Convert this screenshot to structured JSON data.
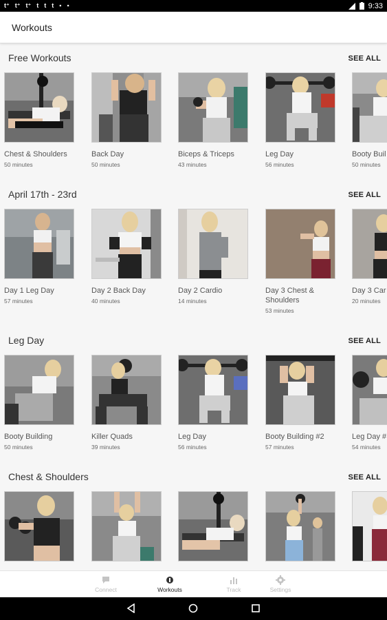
{
  "status_bar": {
    "time": "9:33"
  },
  "app_bar": {
    "title": "Workouts"
  },
  "sections": [
    {
      "title": "Free Workouts",
      "see_all": "SEE ALL",
      "cards": [
        {
          "title": "Chest & Shoulders",
          "duration": "50 minutes"
        },
        {
          "title": "Back Day",
          "duration": "50 minutes"
        },
        {
          "title": "Biceps & Triceps",
          "duration": "43 minutes"
        },
        {
          "title": "Leg Day",
          "duration": "56 minutes"
        },
        {
          "title": "Booty Buil",
          "duration": "50 minutes"
        }
      ]
    },
    {
      "title": "April 17th - 23rd",
      "see_all": "SEE ALL",
      "cards": [
        {
          "title": "Day 1 Leg Day",
          "duration": "57 minutes"
        },
        {
          "title": "Day 2 Back Day",
          "duration": "40 minutes"
        },
        {
          "title": "Day 2 Cardio",
          "duration": "14 minutes"
        },
        {
          "title": "Day 3 Chest & Shoulders",
          "duration": "53 minutes"
        },
        {
          "title": "Day 3 Car",
          "duration": "20 minutes"
        }
      ]
    },
    {
      "title": "Leg Day",
      "see_all": "SEE ALL",
      "cards": [
        {
          "title": "Booty Building",
          "duration": "50 minutes"
        },
        {
          "title": "Killer Quads",
          "duration": "39 minutes"
        },
        {
          "title": "Leg Day",
          "duration": "56 minutes"
        },
        {
          "title": "Booty Building #2",
          "duration": "57 minutes"
        },
        {
          "title": "Leg Day #",
          "duration": "54 minutes"
        }
      ]
    },
    {
      "title": "Chest & Shoulders",
      "see_all": "SEE ALL",
      "cards": []
    }
  ],
  "bottom_nav": [
    {
      "label": "Connect",
      "icon": "chat-bubble-icon",
      "active": false
    },
    {
      "label": "Workouts",
      "icon": "dumbbell-icon",
      "active": true
    },
    {
      "label": "Track",
      "icon": "bar-chart-icon",
      "active": false
    },
    {
      "label": "Settings",
      "icon": "gear-icon",
      "active": false
    }
  ],
  "colors": {
    "background": "#f6f6f6",
    "active_nav": "#222222",
    "inactive_nav": "#bbbbbb"
  }
}
